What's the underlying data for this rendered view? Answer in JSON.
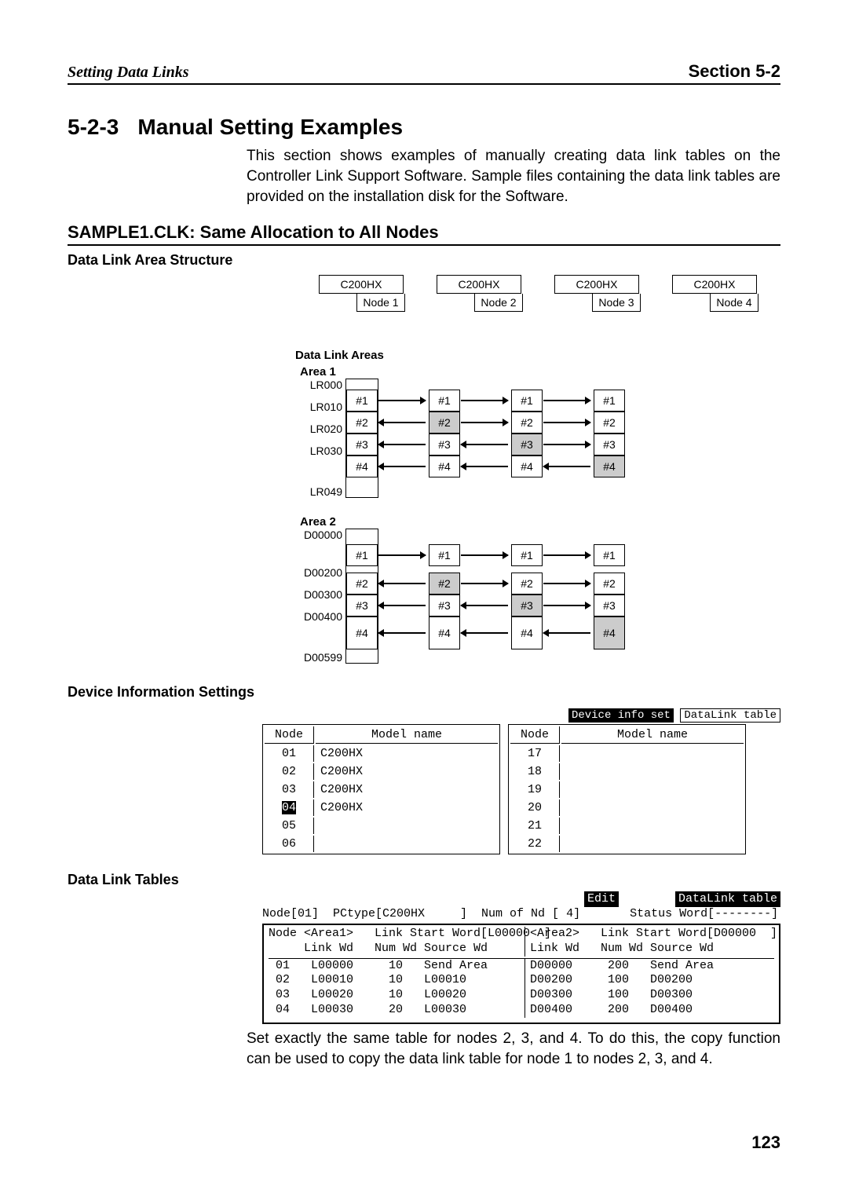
{
  "header": {
    "left": "Setting Data Links",
    "right": "Section 5-2"
  },
  "sec": {
    "num": "5-2-3",
    "title": "Manual Setting Examples"
  },
  "para1": "This section shows examples of manually creating data link tables on the Controller Link Support Software. Sample files containing the data link tables are provided on the installation disk for the Software.",
  "h2": "SAMPLE1.CLK: Same Allocation to All Nodes",
  "h3a": "Data Link Area Structure",
  "nodes": [
    {
      "model": "C200HX",
      "label": "Node 1"
    },
    {
      "model": "C200HX",
      "label": "Node 2"
    },
    {
      "model": "C200HX",
      "label": "Node 3"
    },
    {
      "model": "C200HX",
      "label": "Node 4"
    }
  ],
  "dla_header": "Data Link Areas",
  "area1": {
    "label": "Area 1",
    "addrs": [
      "LR000",
      "LR010",
      "LR020",
      "LR030",
      "LR049"
    ],
    "rows": [
      "#1",
      "#2",
      "#3",
      "#4"
    ]
  },
  "area2": {
    "label": "Area 2",
    "addrs": [
      "D00000",
      "D00200",
      "D00300",
      "D00400",
      "D00599"
    ],
    "rows": [
      "#1",
      "#2",
      "#3",
      "#4"
    ]
  },
  "h3b": "Device Information Settings",
  "dev_tabs": {
    "a": "Device info set",
    "b": "DataLink table"
  },
  "dev_hdr": {
    "node": "Node",
    "model": "Model name"
  },
  "dev_left": [
    {
      "n": "01",
      "m": "C200HX"
    },
    {
      "n": "02",
      "m": "C200HX"
    },
    {
      "n": "03",
      "m": "C200HX"
    },
    {
      "n": "04",
      "m": "C200HX",
      "sel": true
    },
    {
      "n": "05",
      "m": ""
    },
    {
      "n": "06",
      "m": ""
    }
  ],
  "dev_right_nodes": [
    "17",
    "18",
    "19",
    "20",
    "21",
    "22"
  ],
  "h3c": "Data Link Tables",
  "dlt_tabs": {
    "a": "Edit",
    "b": "DataLink table"
  },
  "dlt_line1": "Node[01]  PCtype[C200HX     ]  Num of Nd [ 4]       Status Word[--------]",
  "dlt_hdr_a": "Node <Area1>   Link Start Word[L00000  ]",
  "dlt_hdr_a2": "     Link Wd   Num Wd Source Wd",
  "dlt_hdr_b": "<Area2>   Link Start Word[D00000  ]",
  "dlt_hdr_b2": "Link Wd   Num Wd Source Wd",
  "dlt_rows": [
    {
      "n": "01",
      "a_lw": "L00000",
      "a_nw": "10",
      "a_sw": "Send Area",
      "b_lw": "D00000",
      "b_nw": "200",
      "b_sw": "Send Area"
    },
    {
      "n": "02",
      "a_lw": "L00010",
      "a_nw": "10",
      "a_sw": "L00010",
      "b_lw": "D00200",
      "b_nw": "100",
      "b_sw": "D00200"
    },
    {
      "n": "03",
      "a_lw": "L00020",
      "a_nw": "10",
      "a_sw": "L00020",
      "b_lw": "D00300",
      "b_nw": "100",
      "b_sw": "D00300"
    },
    {
      "n": "04",
      "a_lw": "L00030",
      "a_nw": "20",
      "a_sw": "L00030",
      "b_lw": "D00400",
      "b_nw": "200",
      "b_sw": "D00400"
    }
  ],
  "para2": "Set exactly the same table for nodes 2, 3, and 4. To do this, the copy function can be used to copy the data link table for node 1 to nodes 2, 3, and 4.",
  "pagenum": "123"
}
